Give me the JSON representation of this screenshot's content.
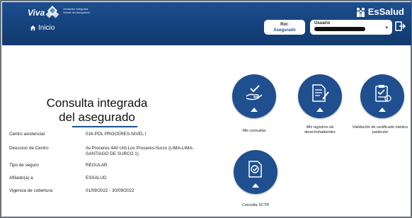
{
  "header": {
    "logo_name": "Viva",
    "logo_subtext": "Ventanilla Integrada Virtual del Asegurado",
    "home_label": "Inicio",
    "brand": "EsSalud",
    "role_label": "Rol:",
    "role_value": "Asegurado",
    "user_label": "Usuario",
    "user_value_redacted": true,
    "colors": {
      "header_bg": "#15427c",
      "accent": "#1f4f8f"
    }
  },
  "main": {
    "title_line1": "Consulta integrada",
    "title_line2": "del asegurado",
    "details": [
      {
        "key": "Centro asistencial",
        "value": "016-POL PROCERES-NIVEL I"
      },
      {
        "key": "Direccion de Centro",
        "value": "Av.Proceres 440 Urb.Los Proceres-Surco (LIMA-LIMA-SANTIAGO DE SURCO 1)"
      },
      {
        "key": "Tipo de seguro",
        "value": "REGULAR"
      },
      {
        "key": "Afiliado(a) a",
        "value": "ESSALUD"
      },
      {
        "key": "Vigencia de cobertura",
        "value": "01/09/2022 - 30/09/2022"
      }
    ]
  },
  "tiles": [
    {
      "label": "Mis consultas",
      "icon": "hand-check-icon"
    },
    {
      "label": "Mis registros de derechohabientes",
      "icon": "document-pen-icon"
    },
    {
      "label": "Validación de certificado médico particular",
      "icon": "clipboard-check-icon"
    },
    {
      "label": "Consulta SCTR",
      "icon": "document-check-icon"
    }
  ]
}
